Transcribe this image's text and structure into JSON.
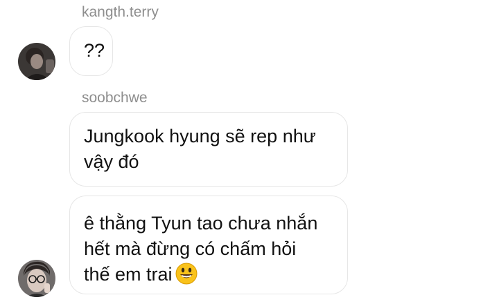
{
  "messages": [
    {
      "sender": "kangth.terry",
      "avatar_icon": "avatar-dark-photo",
      "bubbles": [
        {
          "lines": [
            "??"
          ]
        }
      ]
    },
    {
      "sender": "soobchwe",
      "avatar_icon": "avatar-glasses-photo",
      "bubbles": [
        {
          "lines": [
            "Jungkook hyung sẽ rep như",
            "vậy đó"
          ]
        },
        {
          "lines": [
            "ê thằng Tyun tao chưa nhắn",
            "hết mà đừng có chấm hỏi",
            "thế em trai"
          ],
          "emoji": "grinning-face-emoji"
        }
      ]
    }
  ],
  "colors": {
    "sender_text": "#8e8e8e",
    "bubble_border": "#e6e6e6",
    "message_text": "#111111",
    "background": "#ffffff"
  }
}
